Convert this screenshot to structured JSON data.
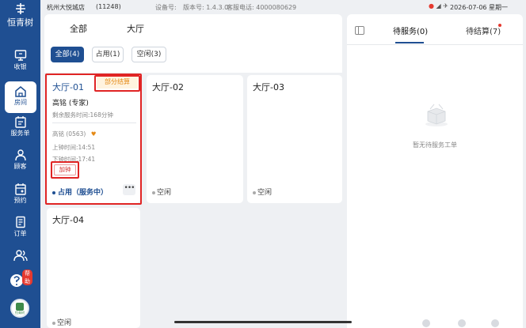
{
  "sidebar": {
    "logo_text": "恒青树",
    "items": [
      {
        "label": "收银",
        "icon": "monitor-icon"
      },
      {
        "label": "房间",
        "icon": "home-icon"
      },
      {
        "label": "服务单",
        "icon": "calendar-list-icon"
      },
      {
        "label": "顾客",
        "icon": "user-icon"
      },
      {
        "label": "预约",
        "icon": "calendar-icon"
      },
      {
        "label": "订单",
        "icon": "document-icon"
      },
      {
        "label": "",
        "icon": "users-icon"
      }
    ],
    "help_badge": "帮助",
    "avatar_text": "恒青树"
  },
  "statusbar": {
    "store": "杭州大悦城店",
    "store_code": "(11248)",
    "device": "设备号:",
    "version": "版本号: 1.4.3.0",
    "phone": "客服电话: 4000080629",
    "datetime": "2026-07-06 星期一"
  },
  "main": {
    "tabs": [
      "全部",
      "大厅"
    ],
    "filters": [
      "全部(4)",
      "占用(1)",
      "空闲(3)"
    ],
    "rooms": [
      {
        "name": "大厅-01",
        "tag": "部分结算",
        "technician": "高铭 (专家)",
        "remaining": "剩余服务时间:168分钟",
        "tech_code": "高铭 (0563)",
        "clock_in": "上钟时间:14:51",
        "clock_out": "下钟时间:17:41",
        "add_clock": "加钟",
        "status": "占用（服务中）",
        "more": "•••"
      },
      {
        "name": "大厅-02",
        "status": "空闲"
      },
      {
        "name": "大厅-03",
        "status": "空闲"
      },
      {
        "name": "大厅-04",
        "status": "空闲"
      }
    ]
  },
  "right_panel": {
    "tabs": [
      "待服务(0)",
      "待结算(7)"
    ],
    "empty_text": "暂无待服务工单"
  },
  "colors": {
    "brand": "#1f4f92",
    "accent_orange": "#e48a16",
    "highlight_red": "#e02424"
  }
}
